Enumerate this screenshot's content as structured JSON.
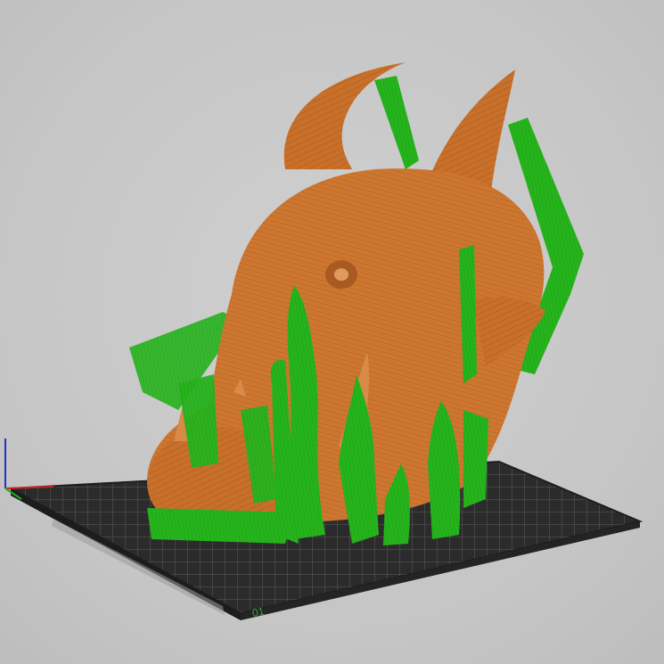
{
  "viewport": {
    "background": "#c9c9c9",
    "bed_label": "01"
  },
  "colors": {
    "model": "#c8702a",
    "model_dark": "#8a4414",
    "model_light": "#e0985a",
    "support": "#22b01a",
    "support_dark": "#137a0e",
    "bed": "#2d2d2d",
    "bed_grid": "#6a6a6a",
    "axis_x": "#cc2222",
    "axis_y": "#22aa22",
    "axis_z": "#2233cc"
  },
  "icons": {
    "axes": "xyz-axes-icon",
    "bed": "print-bed-icon"
  }
}
